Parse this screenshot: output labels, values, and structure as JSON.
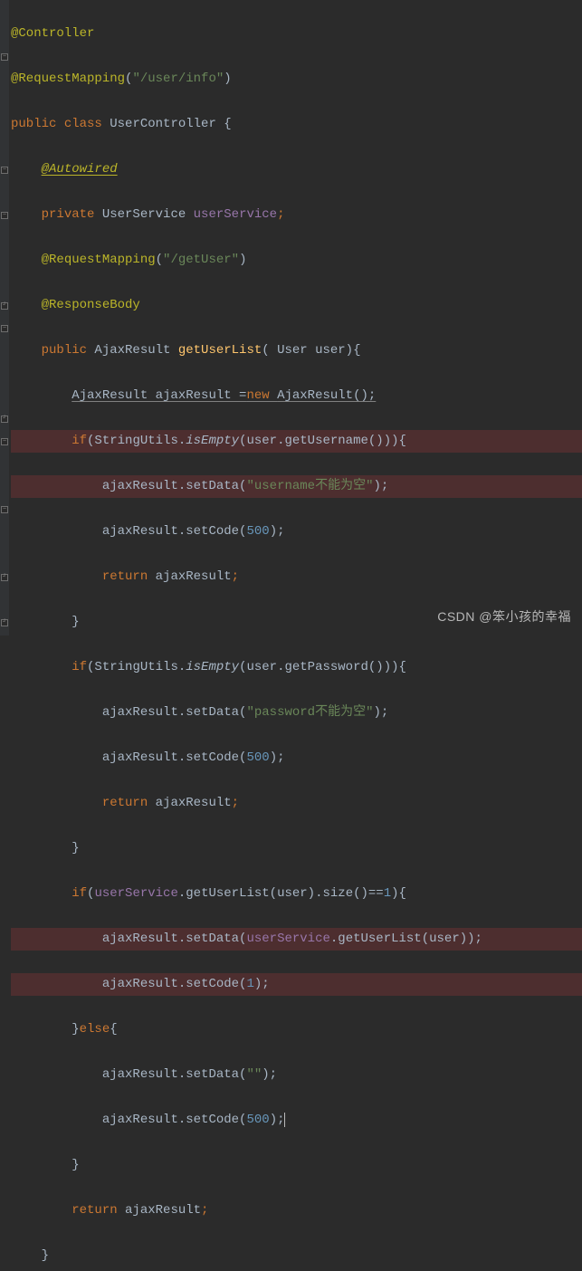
{
  "code": {
    "l1": {
      "annotation": "@Controller"
    },
    "l2": {
      "annotation": "@RequestMapping",
      "p_open": "(",
      "str": "\"/user/info\"",
      "p_close": ")"
    },
    "l3": {
      "kw1": "public ",
      "kw2": "class ",
      "name": "UserController ",
      "brace": "{"
    },
    "l4": {
      "indent": "    ",
      "annotation": "@Autowired"
    },
    "l5": {
      "indent": "    ",
      "kw": "private ",
      "type": "UserService ",
      "field": "userService",
      "semi": ";"
    },
    "l6": {
      "indent": "    ",
      "annotation": "@RequestMapping",
      "p_open": "(",
      "str": "\"/getUser\"",
      "p_close": ")"
    },
    "l7": {
      "indent": "    ",
      "annotation": "@ResponseBody"
    },
    "l8": {
      "indent": "    ",
      "kw": "public ",
      "type": "AjaxResult ",
      "method": "getUserList",
      "params": "( User user){",
      "p_open": "(",
      "p_mid": " User user)",
      "brace": "{"
    },
    "l9": {
      "indent": "        ",
      "stmt_a": "AjaxResult ajaxResult =",
      "kw": "new ",
      "stmt_b": "AjaxResult();"
    },
    "l10": {
      "indent": "        ",
      "kw": "if",
      "p1": "(StringUtils.",
      "m": "isEmpty",
      "p2": "(user.getUsername())){"
    },
    "l11": {
      "indent": "            ",
      "call": "ajaxResult.setData(",
      "str": "\"username不能为空\"",
      "end": ");"
    },
    "l12": {
      "indent": "            ",
      "call": "ajaxResult.setCode(",
      "num": "500",
      "end": ");"
    },
    "l13": {
      "indent": "            ",
      "kw": "return ",
      "var": "ajaxResult",
      "semi": ";"
    },
    "l14": {
      "indent": "        ",
      "brace": "}"
    },
    "l15": {
      "indent": "        ",
      "kw": "if",
      "p1": "(StringUtils.",
      "m": "isEmpty",
      "p2": "(user.getPassword())){"
    },
    "l16": {
      "indent": "            ",
      "call": "ajaxResult.setData(",
      "str": "\"password不能为空\"",
      "end": ");"
    },
    "l17": {
      "indent": "            ",
      "call": "ajaxResult.setCode(",
      "num": "500",
      "end": ");"
    },
    "l18": {
      "indent": "            ",
      "kw": "return ",
      "var": "ajaxResult",
      "semi": ";"
    },
    "l19": {
      "indent": "        ",
      "brace": "}"
    },
    "l20": {
      "indent": "        ",
      "kw": "if",
      "p1": "(",
      "field": "userService",
      "p2": ".getUserList(user).size()==",
      "num": "1",
      "p3": "){"
    },
    "l21": {
      "indent": "            ",
      "call": "ajaxResult.setData(",
      "field": "userService",
      "p2": ".getUserList(user));"
    },
    "l22": {
      "indent": "            ",
      "call": "ajaxResult.setCode(",
      "num": "1",
      "end": ");"
    },
    "l23": {
      "indent": "        ",
      "b1": "}",
      "kw": "else",
      "b2": "{"
    },
    "l24": {
      "indent": "            ",
      "call": "ajaxResult.setData(",
      "str": "\"\"",
      "end": ");"
    },
    "l25": {
      "indent": "            ",
      "call": "ajaxResult.setCode(",
      "num": "500",
      "end": ");"
    },
    "l26": {
      "indent": "        ",
      "brace": "}"
    },
    "l27": {
      "indent": "        ",
      "kw": "return ",
      "var": "ajaxResult",
      "semi": ";"
    },
    "l28": {
      "indent": "    ",
      "brace": "}"
    }
  },
  "watermark": "CSDN @笨小孩的幸福"
}
